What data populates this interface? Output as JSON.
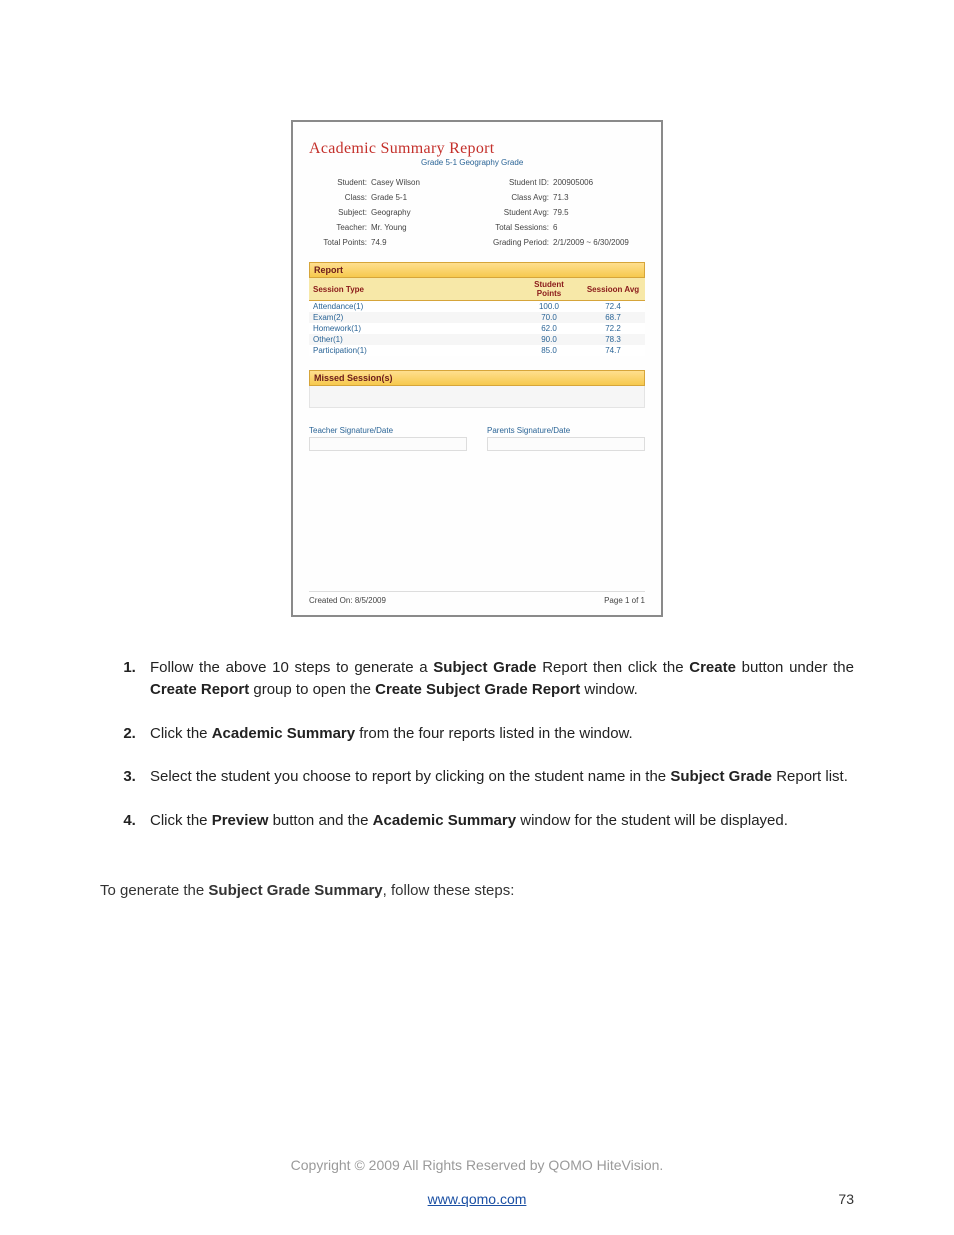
{
  "report": {
    "title": "Academic Summary Report",
    "subtitle": "Grade 5-1 Geography Grade",
    "info": {
      "student_lbl": "Student:",
      "student": "Casey Wilson",
      "student_id_lbl": "Student ID:",
      "student_id": "200905006",
      "class_lbl": "Class:",
      "class": "Grade 5-1",
      "class_avg_lbl": "Class Avg:",
      "class_avg": "71.3",
      "subject_lbl": "Subject:",
      "subject": "Geography",
      "student_avg_lbl": "Student Avg:",
      "student_avg": "79.5",
      "teacher_lbl": "Teacher:",
      "teacher": "Mr. Young",
      "total_sessions_lbl": "Total Sessions:",
      "total_sessions": "6",
      "total_points_lbl": "Total Points:",
      "total_points": "74.9",
      "grading_period_lbl": "Grading Period:",
      "grading_period": "2/1/2009 ~ 6/30/2009"
    },
    "section_report": "Report",
    "table": {
      "cols": {
        "c1": "Session Type",
        "c2": "Student Points",
        "c3": "Sessioon Avg"
      },
      "rows": [
        {
          "type": "Attendance(1)",
          "pts": "100.0",
          "avg": "72.4"
        },
        {
          "type": "Exam(2)",
          "pts": "70.0",
          "avg": "68.7"
        },
        {
          "type": "Homework(1)",
          "pts": "62.0",
          "avg": "72.2"
        },
        {
          "type": "Other(1)",
          "pts": "90.0",
          "avg": "78.3"
        },
        {
          "type": "Participation(1)",
          "pts": "85.0",
          "avg": "74.7"
        }
      ]
    },
    "section_missed": "Missed Session(s)",
    "sig_teacher": "Teacher Signature/Date",
    "sig_parents": "Parents Signature/Date",
    "created_on_lbl": "Created On:",
    "created_on": "8/5/2009",
    "page_of": "Page 1 of 1"
  },
  "steps": {
    "s1_a": "Follow the above 10 steps to generate a ",
    "s1_b1": "Subject Grade",
    "s1_c": " Report then click the ",
    "s1_b2": "Create",
    "s1_d": " button under the ",
    "s1_b3": "Create Report",
    "s1_e": " group to open the ",
    "s1_b4": "Create Subject Grade Report",
    "s1_f": " window.",
    "s2_a": "Click the ",
    "s2_b1": "Academic Summary",
    "s2_c": " from the four reports listed in the window.",
    "s3_a": "Select the student you choose to report by clicking on the student name in the ",
    "s3_b1": "Subject Grade",
    "s3_c": " Report list.",
    "s4_a": "Click the ",
    "s4_b1": "Preview",
    "s4_c": " button and the ",
    "s4_b2": "Academic Summary",
    "s4_d": " window for the student will be displayed."
  },
  "lead_a": "To generate the ",
  "lead_b": "Subject Grade Summary",
  "lead_c": ", follow these steps:",
  "footer": {
    "copyright": "Copyright © 2009 All Rights Reserved by QOMO HiteVision.",
    "link": "www.qomo.com",
    "page_num": "73"
  }
}
